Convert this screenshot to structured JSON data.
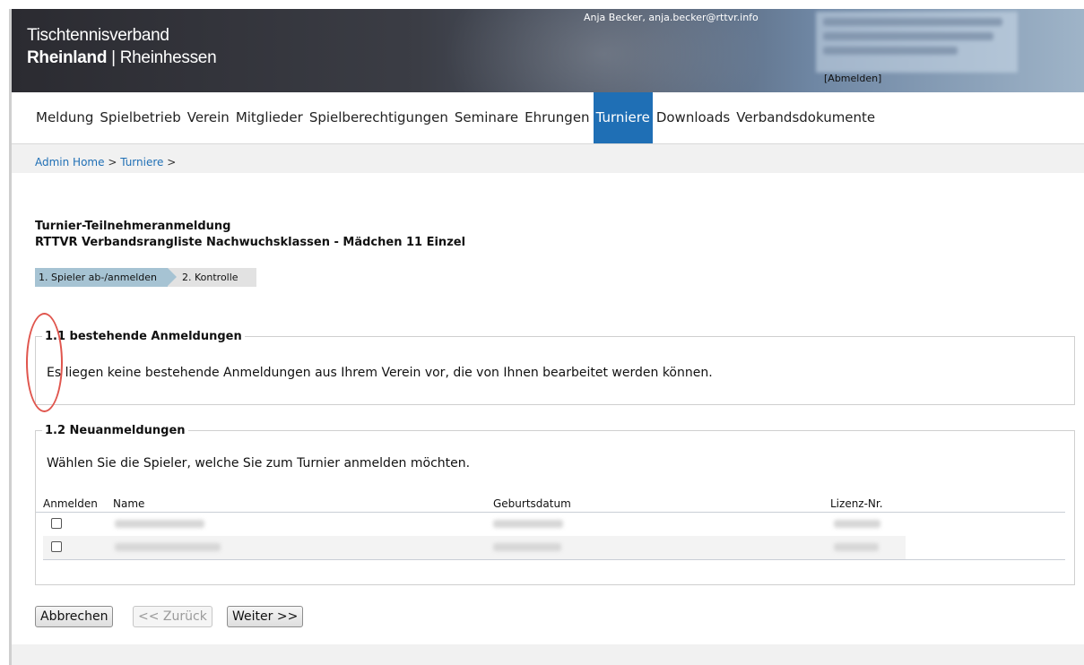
{
  "header": {
    "brand_line1": "Tischtennisverband",
    "brand_bold": "Rheinland",
    "brand_rest": " | Rheinhessen",
    "user_info": "Anja Becker, anja.becker@rttvr.info",
    "logout": "[Abmelden]"
  },
  "nav": {
    "items": [
      {
        "label": "Meldung"
      },
      {
        "label": "Spielbetrieb"
      },
      {
        "label": "Verein"
      },
      {
        "label": "Mitglieder"
      },
      {
        "label": "Spielberechtigungen"
      },
      {
        "label": "Seminare"
      },
      {
        "label": "Ehrungen"
      },
      {
        "label": "Turniere"
      },
      {
        "label": "Downloads"
      },
      {
        "label": "Verbandsdokumente"
      }
    ],
    "active": "Turniere",
    "active_color": "#1f6fb5"
  },
  "breadcrumb": {
    "home": "Admin Home",
    "sep": " > ",
    "section": "Turniere"
  },
  "page": {
    "title": "Turnier-Teilnehmeranmeldung",
    "subtitle": "RTTVR Verbandsrangliste Nachwuchsklassen - Mädchen 11 Einzel"
  },
  "steps": [
    {
      "label": "1. Spieler ab-/anmelden",
      "active": true
    },
    {
      "label": "2. Kontrolle",
      "active": false
    }
  ],
  "existing": {
    "legend": "1.1 bestehende Anmeldungen",
    "message": "Es liegen keine bestehende Anmeldungen aus Ihrem Verein vor, die von Ihnen bearbeitet werden können."
  },
  "new_registrations": {
    "legend": "1.2 Neuanmeldungen",
    "message": "Wählen Sie die Spieler, welche Sie zum Turnier anmelden möchten.",
    "columns": {
      "register": "Anmelden",
      "name": "Name",
      "birthdate": "Geburtsdatum",
      "license": "Lizenz-Nr."
    },
    "rows": [
      {
        "checked": false
      },
      {
        "checked": false
      }
    ]
  },
  "buttons": {
    "cancel": "Abbrechen",
    "back": "<< Zurück",
    "next": "Weiter >>"
  },
  "annotation_color": "#e0554d"
}
